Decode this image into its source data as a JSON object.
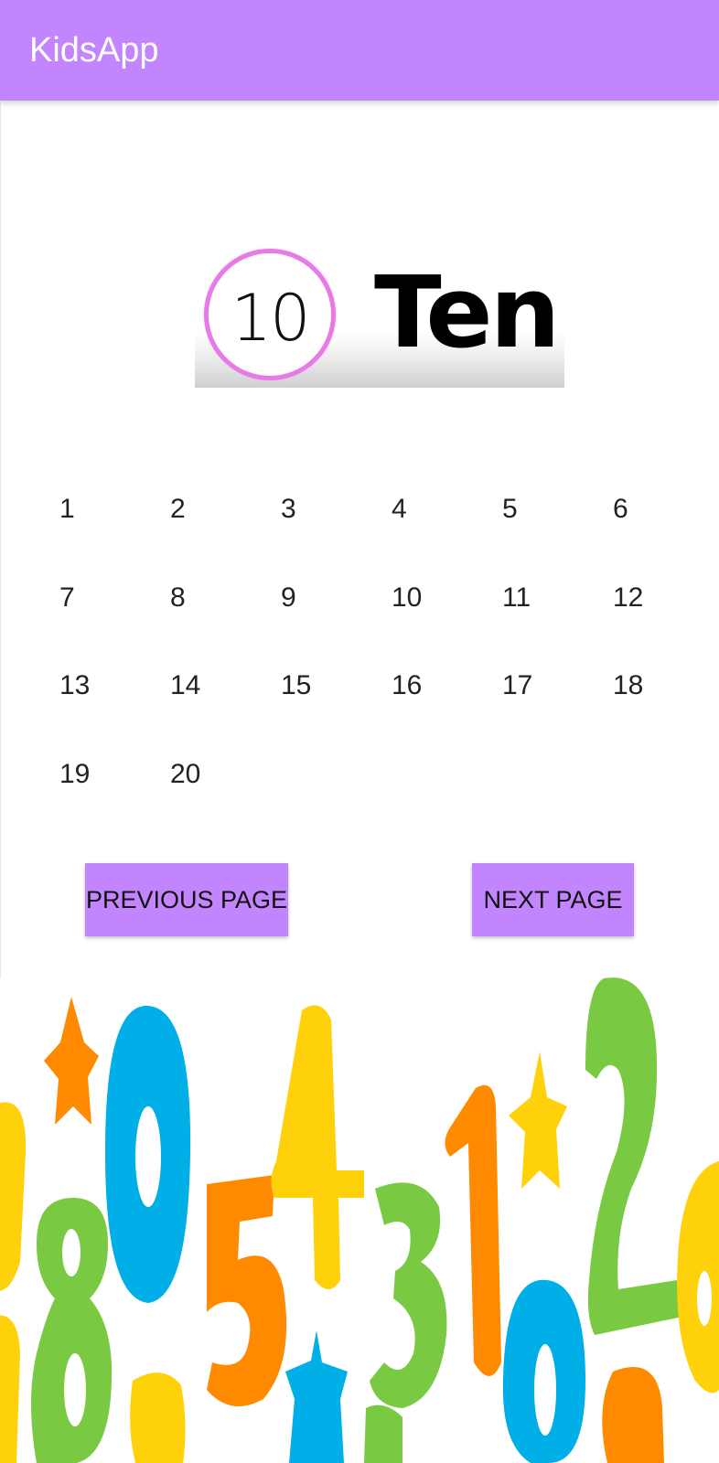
{
  "app_bar": {
    "title": "KidsApp",
    "color": "#c285fd"
  },
  "number_card": {
    "digit": "10",
    "word": "Ten",
    "circle_color": "#e77ae6"
  },
  "number_grid": [
    [
      "1",
      "2",
      "3",
      "4",
      "5",
      "6"
    ],
    [
      "7",
      "8",
      "9",
      "10",
      "11",
      "12"
    ],
    [
      "13",
      "14",
      "15",
      "16",
      "17",
      "18"
    ],
    [
      "19",
      "20"
    ]
  ],
  "buttons": {
    "previous": "PREVIOUS PAGE",
    "next": "NEXT PAGE"
  },
  "decoration": {
    "art": "colorful-numbers-banner",
    "colors": [
      "#ffd10a",
      "#00aee8",
      "#ff8a00",
      "#7ac943"
    ]
  }
}
